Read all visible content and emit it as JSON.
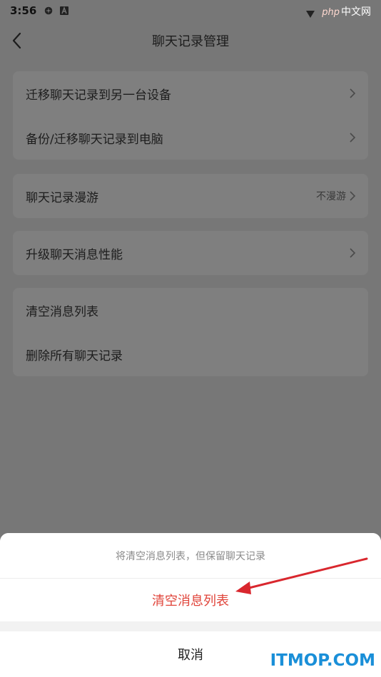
{
  "status_bar": {
    "time": "3:56",
    "icons": [
      "alarm-icon",
      "a-icon",
      "signal-icon"
    ],
    "watermark": {
      "php": "php",
      "cn": "中文网"
    }
  },
  "header": {
    "title": "聊天记录管理",
    "back_icon": "chevron-left-icon"
  },
  "groups": [
    {
      "items": [
        {
          "label": "迁移聊天记录到另一台设备",
          "value": "",
          "chevron": true
        },
        {
          "label": "备份/迁移聊天记录到电脑",
          "value": "",
          "chevron": true
        }
      ]
    },
    {
      "items": [
        {
          "label": "聊天记录漫游",
          "value": "不漫游",
          "chevron": true
        }
      ]
    },
    {
      "items": [
        {
          "label": "升级聊天消息性能",
          "value": "",
          "chevron": true
        }
      ]
    },
    {
      "items": [
        {
          "label": "清空消息列表",
          "value": "",
          "chevron": false
        },
        {
          "label": "删除所有聊天记录",
          "value": "",
          "chevron": false
        }
      ]
    }
  ],
  "action_sheet": {
    "hint": "将清空消息列表，但保留聊天记录",
    "confirm_label": "清空消息列表",
    "cancel_label": "取消"
  },
  "watermark_bottom": "ITMOP.COM",
  "colors": {
    "overlay_bg": "#777777",
    "danger": "#e0443a",
    "annotation_arrow": "#d9272e"
  }
}
